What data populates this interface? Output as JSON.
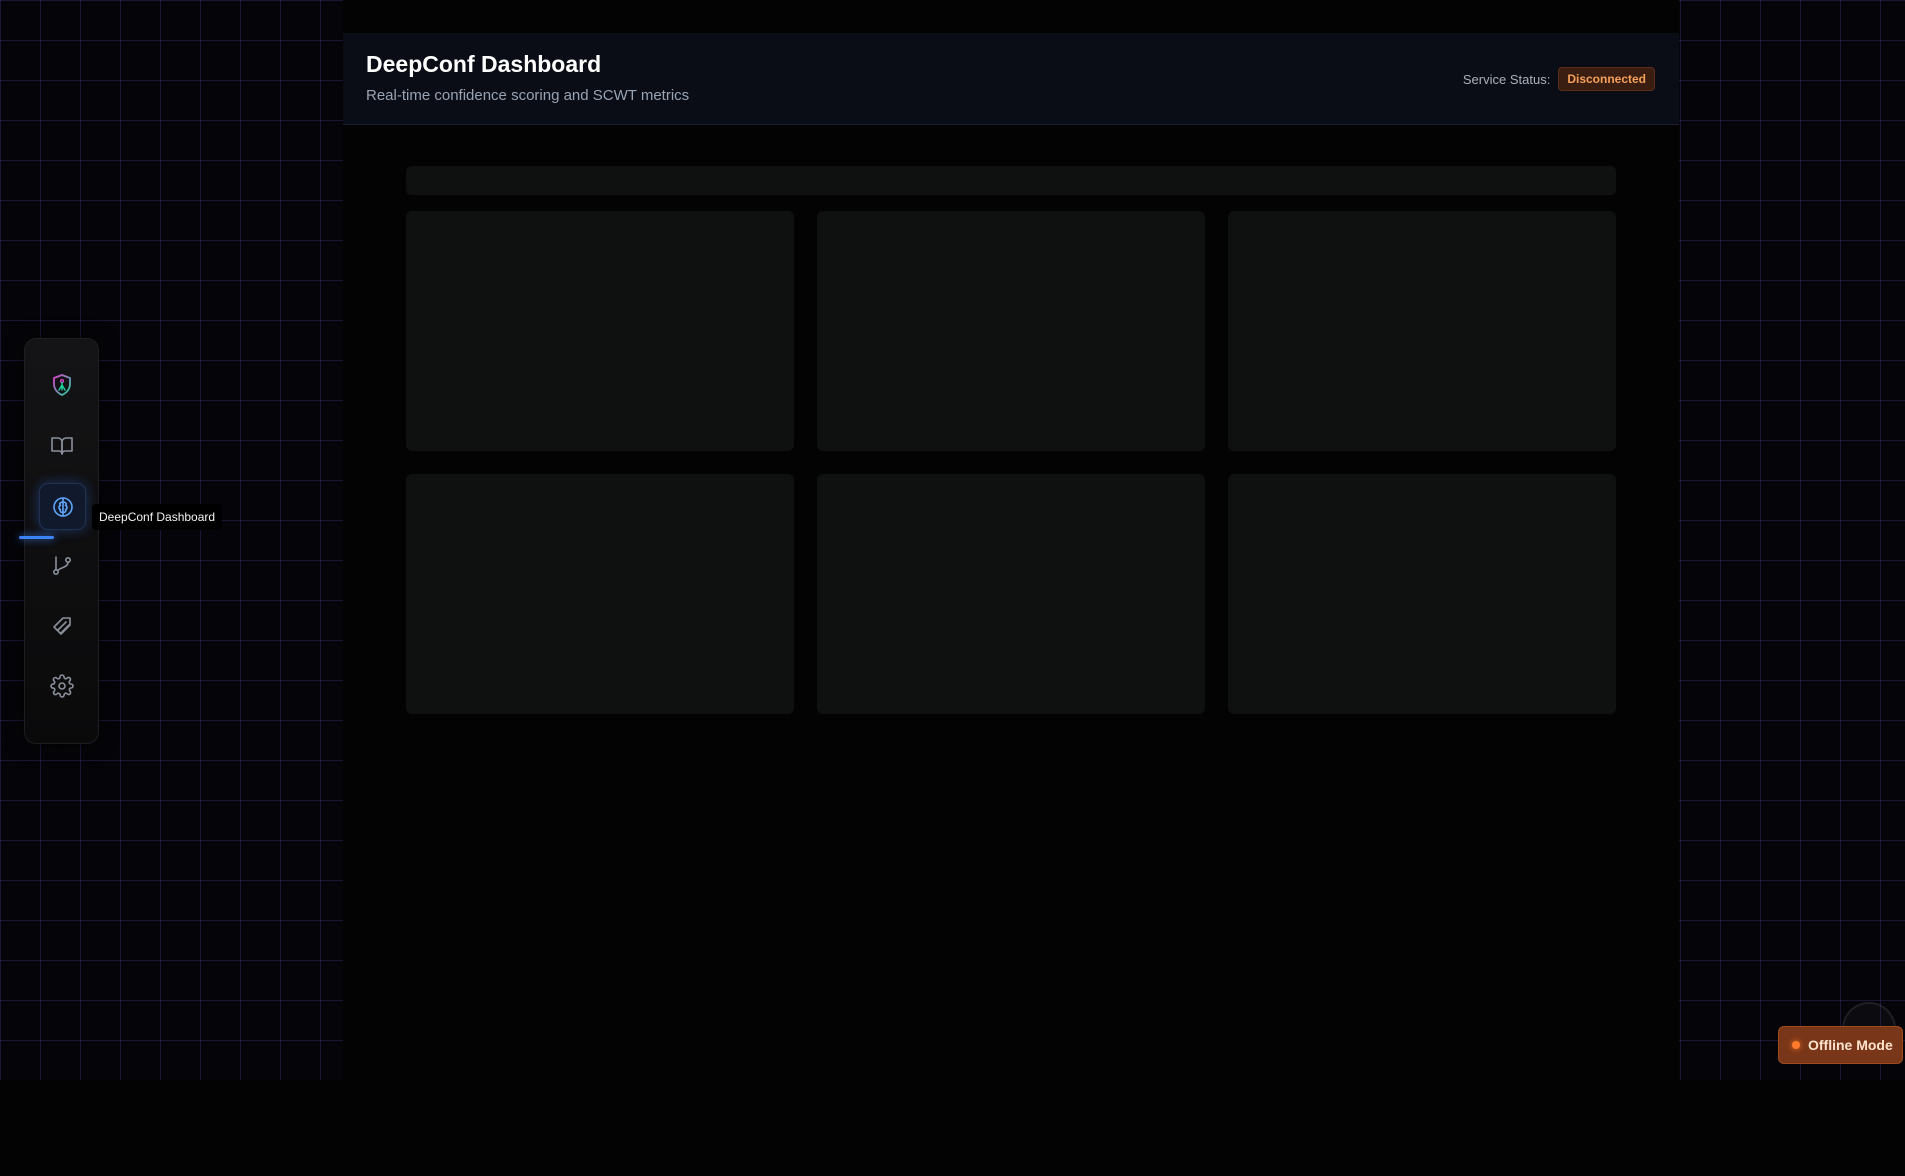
{
  "header": {
    "title": "DeepConf Dashboard",
    "subtitle": "Real-time confidence scoring and SCWT metrics",
    "service_status_label": "Service Status:",
    "service_status_value": "Disconnected"
  },
  "sidebar": {
    "items": [
      {
        "name": "logo",
        "icon": "shield-logo-icon"
      },
      {
        "name": "knowledge",
        "icon": "book-open-icon"
      },
      {
        "name": "deepconf",
        "icon": "brain-icon",
        "active": true
      },
      {
        "name": "git",
        "icon": "git-branch-icon"
      },
      {
        "name": "layers",
        "icon": "layers-icon"
      },
      {
        "name": "settings",
        "icon": "gear-icon"
      }
    ],
    "tooltip": "DeepConf Dashboard"
  },
  "footer": {
    "offline_label": "Offline Mode"
  },
  "colors": {
    "accent": "#3b82f6",
    "status_bad": "#f6a05a",
    "offline_bg": "#7a3618"
  }
}
